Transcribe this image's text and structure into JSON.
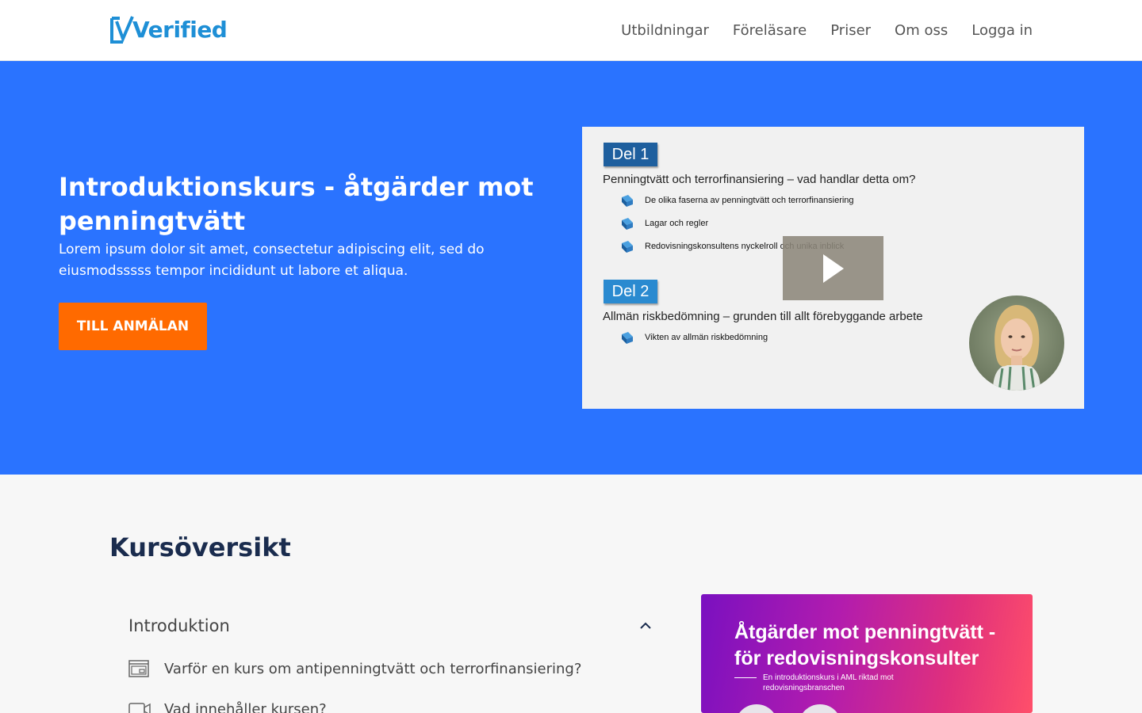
{
  "header": {
    "logo_text": "Verified",
    "nav": [
      "Utbildningar",
      "Föreläsare",
      "Priser",
      "Om oss",
      "Logga in"
    ]
  },
  "hero": {
    "title": "Introduktionskurs - åtgärder mot penningtvätt",
    "description": "Lorem ipsum dolor sit amet, consectetur adipiscing elit, sed do eiusmodsssss tempor incididunt ut labore et aliqua.",
    "cta_label": "TILL ANMÄLAN"
  },
  "video": {
    "part1": {
      "badge": "Del 1",
      "heading": "Penningtvätt och  terrorfinansiering – vad handlar detta om?",
      "bullets": [
        "De olika faserna av penningtvätt och terrorfinansiering",
        "Lagar och regler",
        "Redovisningskonsultens nyckelroll och unika inblick"
      ]
    },
    "part2": {
      "badge": "Del 2",
      "heading": "Allmän riskbedömning – grunden till allt förebyggande arbete",
      "bullets": [
        "Vikten av allmän riskbedömning"
      ]
    }
  },
  "overview": {
    "title": "Kursöversikt",
    "section_title": "Introduktion",
    "lessons": [
      "Varför en kurs om antipenningtvätt och terrorfinansiering?",
      "Vad innehåller kursen?"
    ]
  },
  "promo": {
    "title": "Åtgärder mot penningtvätt - för redovisningskonsulter",
    "subtitle": "En introduktionskurs i AML riktad mot redovisningsbranschen"
  },
  "colors": {
    "hero_bg": "#2a73ff",
    "cta": "#ff6a00",
    "brand": "#1e8fd6",
    "heading": "#1a2c4e"
  }
}
